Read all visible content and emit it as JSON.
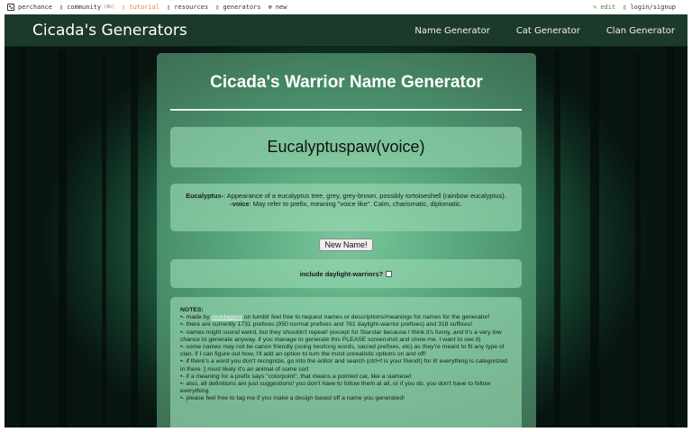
{
  "topbar": {
    "items": [
      {
        "label": "perchance"
      },
      {
        "label": "community",
        "badge": "(8h)"
      },
      {
        "label": "tutorial"
      },
      {
        "label": "resources"
      },
      {
        "label": "generators"
      },
      {
        "label": "new"
      }
    ],
    "edit_label": "edit",
    "login_label": "login/signup"
  },
  "navbar": {
    "brand": "Cicada's Generators",
    "links": [
      "Name Generator",
      "Cat Generator",
      "Clan Generator"
    ]
  },
  "main": {
    "title": " Cicada's Warrior Name Generator ",
    "title_icon_left": "paw-icon",
    "title_icon_right": "paw-icon",
    "generated_name": "Eucalyptuspaw(voice)",
    "description": {
      "prefix_term": "Eucalyptus-",
      "prefix_text": ": Appearance of a eucalyptus tree, grey, grey-brown, possibly tortoiseshell (rainbow eucalyptus).",
      "suffix_term": "-voice",
      "suffix_text": ": May refer to prefix, meaning \"voice like\". Calm, charismatic, diplomatic."
    },
    "new_name_button": "New Name!",
    "option_label": "include daylight-warriors?",
    "option_checked": false,
    "notes": {
      "header": "NOTES:",
      "lines": [
        {
          "pre": "•- made by ",
          "link": "cicadagaze",
          "post": " on tumblr feel free to request names or descriptions/meanings for names for the generator!"
        },
        {
          "text": "•- there are currently 1731 prefixes (950 normal prefixes and 781 daylight-warrior prefixes) and 318 suffixes!"
        },
        {
          "text": "•- names might sound weird, but they shouldn't repeat! (except for Starstar because I think it's funny, and it's a very low chance to generate anyway. if you manage to generate this PLEASE screenshot and show me. I want to see it)"
        },
        {
          "text": "•- some names may not be canon friendly (using two/long words, sacred prefixes, etc) as they're meant to fit any type of clan. if I can figure out how, I'll add an option to turn the most unrealistic options on and off!"
        },
        {
          "text": "•- if there's a word you don't recognize, go into the editor and search (ctrl+f is your friend!) for it! everything is categorized in there :] most likely it's an animal of some sort"
        },
        {
          "text": "•- if a meaning for a prefix says \"colorpoint\", that means a pointed cat, like a siamese!"
        },
        {
          "text": "•- also, all definitions are just suggestions! you don't have to follow them at all, or if you do, you don't have to follow everything."
        },
        {
          "text": "•- please feel free to tag me if you make a design based off a name you generated!"
        }
      ]
    }
  },
  "colors": {
    "navbar_bg": "#1c3a2a",
    "panel_bg": "rgba(110,190,145,0.55)",
    "tutorial_link": "#d98a2b",
    "edit_link": "#3a8a3a"
  }
}
